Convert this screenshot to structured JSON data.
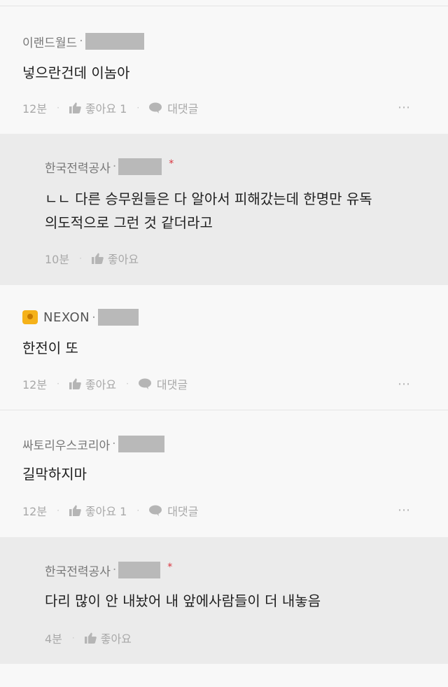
{
  "comments": [
    {
      "author": "이랜드월드",
      "text_lines": [
        "넣으란건데 이놈아"
      ],
      "time": "12분",
      "like_label": "좋아요 1",
      "reply_label": "대댓글",
      "more": "⋯"
    },
    {
      "author": "한국전력공사",
      "text_lines": [
        "ㄴㄴ 다른 승무원들은 다 알아서 피해갔는데 한명만 유독",
        "의도적으로 그런 것 같더라고"
      ],
      "time": "10분",
      "like_label": "좋아요",
      "star": "*"
    },
    {
      "author": "NEXON",
      "text_lines": [
        "한전이 또"
      ],
      "time": "12분",
      "like_label": "좋아요",
      "reply_label": "대댓글",
      "more": "⋯"
    },
    {
      "author": "싸토리우스코리아",
      "text_lines": [
        "길막하지마"
      ],
      "time": "12분",
      "like_label": "좋아요 1",
      "reply_label": "대댓글",
      "more": "⋯"
    },
    {
      "author": "한국전력공사",
      "text_lines": [
        "다리 많이 안 내놨어 내 앞에사람들이 더 내놓음"
      ],
      "time": "4분",
      "like_label": "좋아요",
      "star": "*"
    }
  ],
  "author_separator": "·",
  "meta_separator": "·",
  "icons": {
    "like": "thumbs-up-icon",
    "reply": "speech-bubble-icon",
    "badge": "nexon-badge-icon"
  },
  "colors": {
    "background": "#f8f8f8",
    "reply_background": "#ebebeb",
    "star": "#d8323c"
  }
}
